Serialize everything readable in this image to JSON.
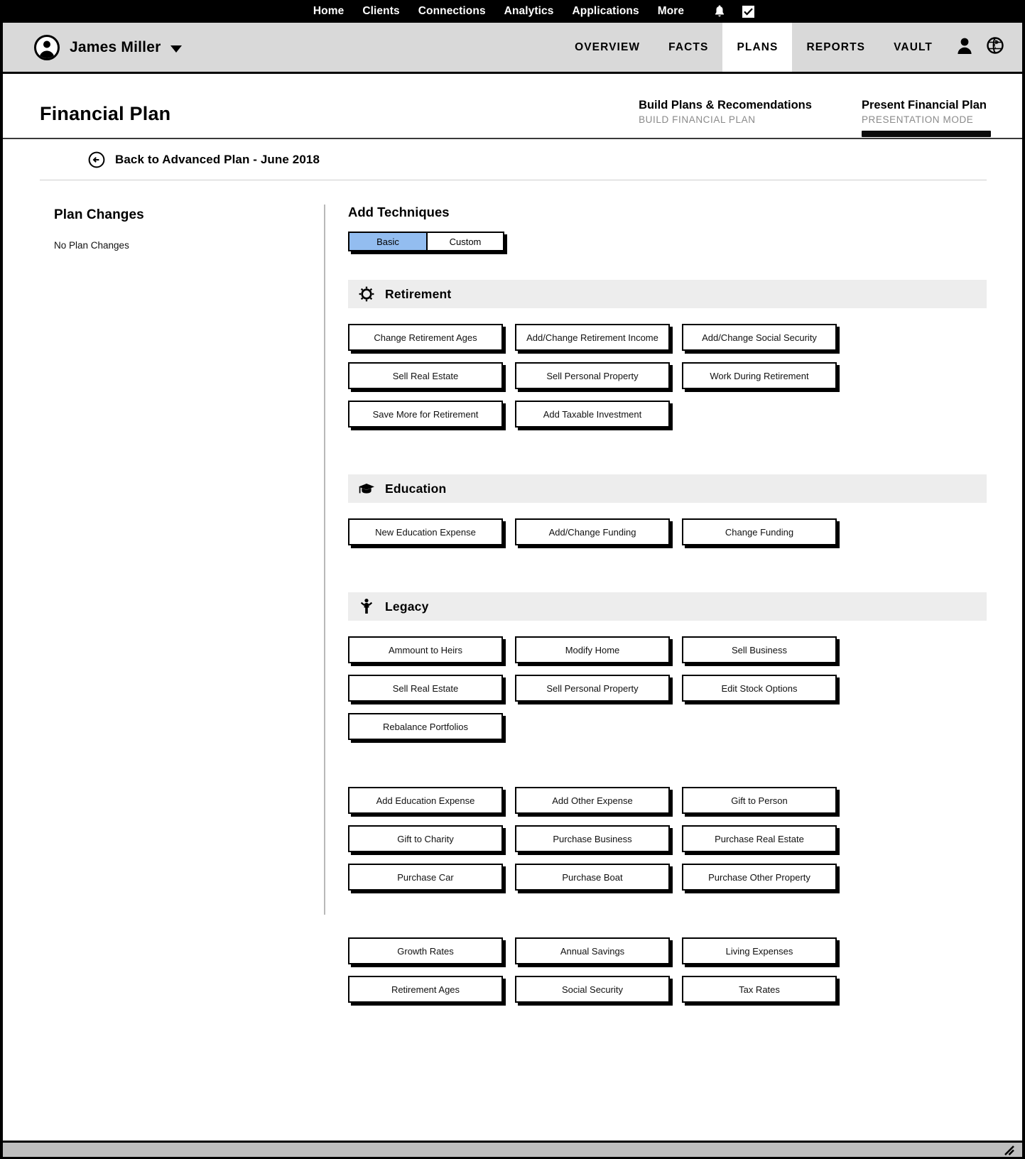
{
  "topnav": {
    "items": [
      "Home",
      "Clients",
      "Connections",
      "Analytics",
      "Applications",
      "More"
    ],
    "icons": [
      {
        "name": "notifications-bell-icon"
      },
      {
        "name": "tasks-checkbox-icon"
      }
    ]
  },
  "clientbar": {
    "avatar_icon": "user-avatar-icon",
    "client_name": "James Miller",
    "dropdown_icon": "chevron-down-icon",
    "tabs": [
      {
        "label": "OVERVIEW",
        "active": false
      },
      {
        "label": "FACTS",
        "active": false
      },
      {
        "label": "PLANS",
        "active": true
      },
      {
        "label": "REPORTS",
        "active": false
      },
      {
        "label": "VAULT",
        "active": false
      }
    ],
    "icons": [
      {
        "name": "person-icon"
      },
      {
        "name": "globe-icon"
      }
    ]
  },
  "page": {
    "title": "Financial Plan",
    "modes": [
      {
        "title": "Build Plans & Recomendations",
        "subtitle": "BUILD FINANCIAL PLAN",
        "active": false
      },
      {
        "title": "Present Financial Plan",
        "subtitle": "PRESENTATION MODE",
        "active": true
      }
    ],
    "back_link": {
      "icon": "back-arrow-circle-icon",
      "label": "Back to Advanced Plan - June 2018"
    }
  },
  "left_pane": {
    "title": "Plan Changes",
    "empty_text": "No Plan Changes"
  },
  "right_pane": {
    "title": "Add Techniques",
    "segmented": {
      "options": [
        {
          "label": "Basic",
          "active": true
        },
        {
          "label": "Custom",
          "active": false
        }
      ]
    },
    "sections": [
      {
        "id": "retirement",
        "icon": "sun-icon",
        "title": "Retirement",
        "buttons": [
          "Change Retirement Ages",
          "Add/Change Retirement Income",
          "Add/Change Social Security",
          "Sell Real Estate",
          "Sell Personal Property",
          "Work During Retirement",
          "Save More for Retirement",
          "Add Taxable Investment"
        ]
      },
      {
        "id": "education",
        "icon": "graduation-cap-icon",
        "title": "Education",
        "buttons": [
          "New Education Expense",
          "Add/Change Funding",
          "Change Funding"
        ]
      },
      {
        "id": "legacy",
        "icon": "person-arms-up-icon",
        "title": "Legacy",
        "buttons": [
          "Ammount to Heirs",
          "Modify Home",
          "Sell Business",
          "Sell Real Estate",
          "Sell Personal Property",
          "Edit Stock Options",
          "Rebalance Portfolios"
        ]
      }
    ],
    "extra_groups": [
      {
        "id": "expenses-purchases",
        "buttons": [
          "Add Education Expense",
          "Add Other Expense",
          "Gift to Person",
          "Gift to Charity",
          "Purchase Business",
          "Purchase Real Estate",
          "Purchase Car",
          "Purchase Boat",
          "Purchase Other Property"
        ]
      },
      {
        "id": "assumptions",
        "buttons": [
          "Growth Rates",
          "Annual Savings",
          "Living Expenses",
          "Retirement Ages",
          "Social Security",
          "Tax Rates"
        ]
      }
    ]
  },
  "statusbar": {
    "resize_icon": "resize-grip-icon"
  },
  "colors": {
    "topbar_bg": "#000000",
    "clientbar_bg": "#d9d9d9",
    "section_head_bg": "#ededed",
    "segment_active_bg": "#93bdf0",
    "statusbar_bg": "#bebebe",
    "muted_text": "#8a8a8a"
  }
}
